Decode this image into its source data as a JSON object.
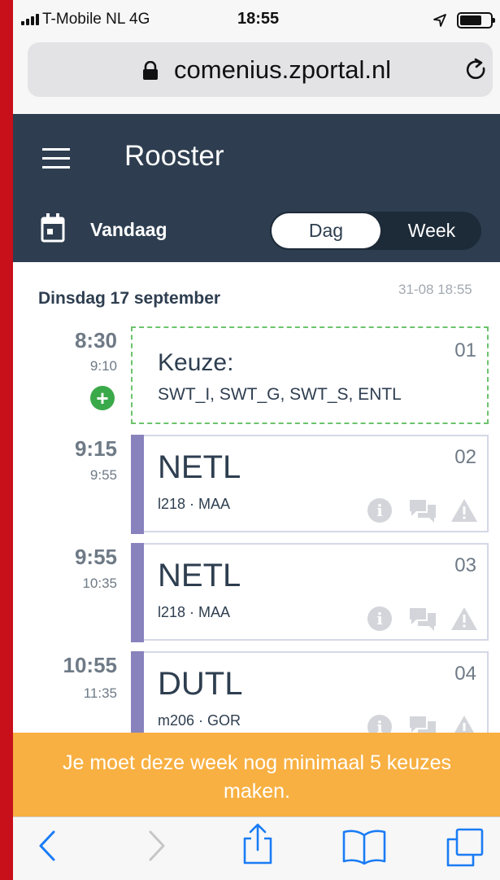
{
  "status_bar": {
    "carrier": "T-Mobile NL  4G",
    "time": "18:55"
  },
  "browser": {
    "url": "comenius.zportal.nl"
  },
  "header": {
    "title": "Rooster",
    "today_label": "Vandaag",
    "view_options": [
      "Dag",
      "Week"
    ],
    "selected_view": "Dag"
  },
  "schedule": {
    "date": "Dinsdag 17 september",
    "updated": "31-08 18:55",
    "choice": {
      "start": "8:30",
      "end": "9:10",
      "title": "Keuze:",
      "options": "SWT_I, SWT_G, SWT_S, ENTL",
      "hour": "01"
    },
    "lessons": [
      {
        "start": "9:15",
        "end": "9:55",
        "subject": "NETL",
        "meta": "l218 · MAA",
        "hour": "02"
      },
      {
        "start": "9:55",
        "end": "10:35",
        "subject": "NETL",
        "meta": "l218 · MAA",
        "hour": "03"
      },
      {
        "start": "10:55",
        "end": "11:35",
        "subject": "DUTL",
        "meta": "m206 · GOR",
        "hour": "04"
      }
    ]
  },
  "banner": {
    "text": "Je moet deze week nog minimaal 5 keuzes maken."
  },
  "colors": {
    "header_bg": "#2e3e50",
    "lesson_bar": "#8882bd",
    "choice_border": "#6cc36c",
    "add_button": "#3aa94a",
    "banner_bg": "#f8b042",
    "ios_blue": "#1a7cf5"
  },
  "icons": {
    "menu": "menu-icon",
    "calendar": "calendar-icon",
    "info": "info-icon",
    "chat": "chat-icon",
    "warning": "warning-icon",
    "back": "back-icon",
    "forward": "forward-icon",
    "share": "share-icon",
    "bookmarks": "bookmarks-icon",
    "tabs": "tabs-icon"
  }
}
